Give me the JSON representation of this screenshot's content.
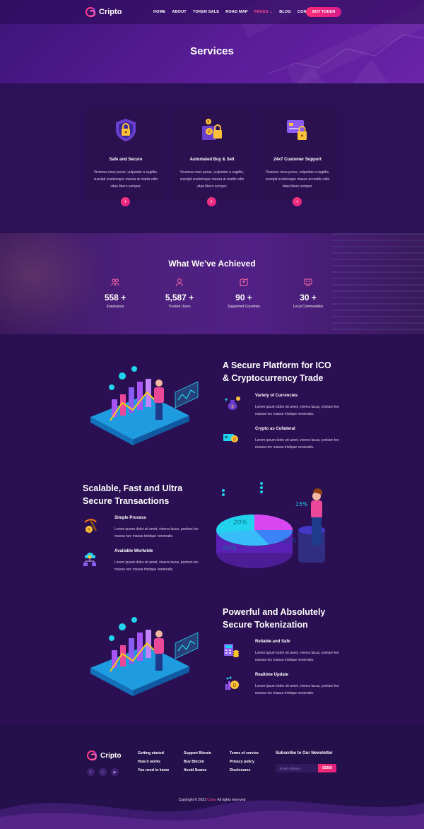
{
  "brand": {
    "name": "Cripto"
  },
  "nav": {
    "items": [
      {
        "label": "HOME"
      },
      {
        "label": "ABOUT"
      },
      {
        "label": "TOKEN SALE"
      },
      {
        "label": "ROAD MAP"
      },
      {
        "label": "PAGES"
      },
      {
        "label": "BLOG"
      },
      {
        "label": "CONTACT"
      }
    ],
    "active": "PAGES",
    "cta": "BUY TOKEN"
  },
  "page_title": "Services",
  "services": [
    {
      "title": "Safe and Secure",
      "desc": "Vivamus risus purus, vulputate a sagittis, suscipit scelerisque massa at mattis odio vitae libero semper.",
      "icon": "shield-lock-icon"
    },
    {
      "title": "Automated Buy & Sell",
      "desc": "Vivamus risus purus, vulputate a sagittis, suscipit scelerisque massa at mattis odio vitae libero semper.",
      "icon": "wallet-coins-icon"
    },
    {
      "title": "24x7 Customer Support",
      "desc": "Vivamus risus purus, vulputate a sagittis, suscipit scelerisque massa at mattis odio vitae libero semper.",
      "icon": "card-lock-icon"
    }
  ],
  "stats": {
    "title": "What We’ve Achieved",
    "items": [
      {
        "value": "558 +",
        "label": "Employees",
        "icon": "people-icon"
      },
      {
        "value": "5,587 +",
        "label": "Trusted Users",
        "icon": "user-icon"
      },
      {
        "value": "90 +",
        "label": "Supported Countries",
        "icon": "map-pin-icon"
      },
      {
        "value": "30 +",
        "label": "Local Communities",
        "icon": "community-icon"
      }
    ]
  },
  "features": [
    {
      "title_line1": "A Secure Platform for ICO",
      "title_line2": "& Cryptocurrency Trade",
      "items": [
        {
          "title": "Variety of Currencies",
          "desc": "Lorem ipsum dolor sit amet, viverra lacus, pretium leo massa nec massa tristique venenatis.",
          "icon": "money-bag-icon"
        },
        {
          "title": "Crypto as Collateral",
          "desc": "Lorem ipsum dolor sit amet, viverra lacus, pretium leo massa nec massa tristique venenatis.",
          "icon": "card-coin-icon"
        }
      ]
    },
    {
      "title_line1": "Scalable, Fast and Ultra",
      "title_line2": "Secure Transactions",
      "items": [
        {
          "title": "Simple Process",
          "desc": "Lorem ipsum dolor sit amet, viverra lacus, pretium leo massa nec massa tristique venenatis.",
          "icon": "pickaxe-coin-icon"
        },
        {
          "title": "Available Worlwide",
          "desc": "Lorem ipsum dolor sit amet, viverra lacus, pretium leo massa nec massa tristique venenatis.",
          "icon": "cloud-network-icon"
        }
      ],
      "pie_labels": [
        "20%",
        "25%",
        "40%",
        "15%"
      ]
    },
    {
      "title_line1": "Powerful and Absolutely",
      "title_line2": "Secure Tokenization",
      "items": [
        {
          "title": "Reliable and Safe",
          "desc": "Lorem ipsum dolor sit amet, viverra lacus, pretium leo massa nec massa tristique venenatis.",
          "icon": "calculator-coins-icon"
        },
        {
          "title": "Realtime Update",
          "desc": "Lorem ipsum dolor sit amet, viverra lacus, pretium leo massa nec massa tristique venenatis.",
          "icon": "chart-coin-icon"
        }
      ]
    }
  ],
  "footer": {
    "columns": [
      [
        "Getting started",
        "How it works",
        "You need to know"
      ],
      [
        "Support Bitcoin",
        "Buy Bitcoin",
        "Avoid Scams"
      ],
      [
        "Terms of service",
        "Privacy policy",
        "Disclosures"
      ]
    ],
    "newsletter": {
      "title": "Subscribe to Our Newsletter",
      "placeholder": "Email Address",
      "button": "SEND"
    },
    "social": [
      "facebook-icon",
      "twitter-icon",
      "youtube-icon"
    ],
    "copyright_prefix": "Copyright © 2021",
    "copyright_brand": "Cripto",
    "copyright_suffix": "All rights reserved"
  },
  "colors": {
    "background": "#2a0f52",
    "accent": "#ff2d74",
    "card": "#2b1150",
    "footer": "#24104a"
  }
}
